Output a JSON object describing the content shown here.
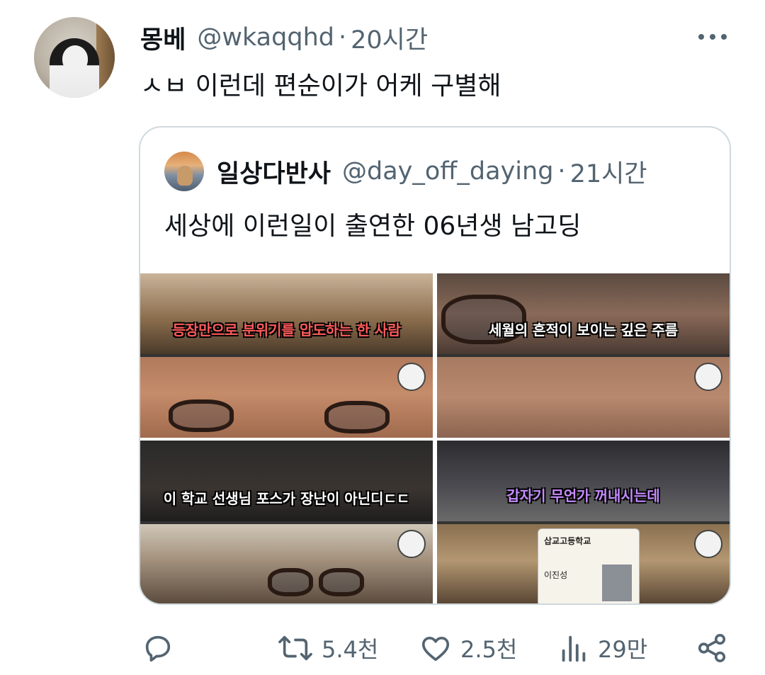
{
  "tweet": {
    "author_name": "몽베",
    "handle": "@wkaqqhd",
    "separator": "·",
    "time": "20시간",
    "text": "ㅅㅂ 이런데 편순이가 어케 구별해"
  },
  "quote": {
    "author_name": "일상다반사",
    "handle": "@day_off_daying",
    "separator": "·",
    "time": "21시간",
    "text": "세상에 이런일이 출연한 06년생 남고딩",
    "media": [
      {
        "caption": "등장만으로 분위기를 압도하는 한 사람"
      },
      {
        "caption": "세월의 흔적이 보이는 깊은 주름"
      },
      {
        "caption": "이 학교 선생님 포스가 장난이 아닌디ㄷㄷ"
      },
      {
        "caption": "갑자기 무언가 꺼내시는데",
        "card_school": "삽교고등학교",
        "card_name": "이진성"
      }
    ]
  },
  "actions": {
    "reply": {
      "icon": "reply-icon",
      "count": ""
    },
    "retweet": {
      "icon": "retweet-icon",
      "count": "5.4천"
    },
    "like": {
      "icon": "heart-icon",
      "count": "2.5천"
    },
    "views": {
      "icon": "views-icon",
      "count": "29만"
    },
    "share": {
      "icon": "share-icon",
      "count": ""
    }
  },
  "colors": {
    "text_primary": "#0f1419",
    "text_secondary": "#536471",
    "border": "#cfd9de",
    "caption_red": "#ff5a5a",
    "caption_purple": "#c58bff"
  }
}
